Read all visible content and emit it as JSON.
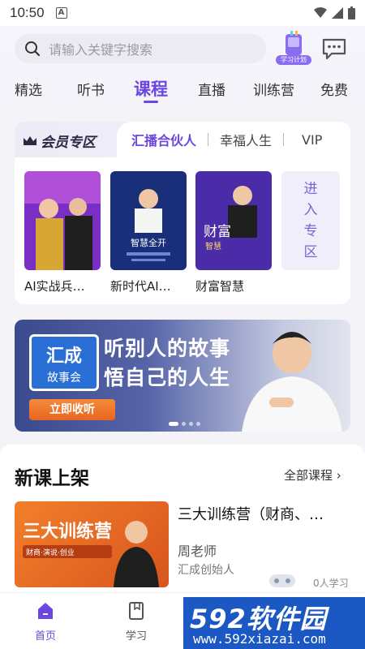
{
  "status_bar": {
    "time": "10:50",
    "badge": "A"
  },
  "search": {
    "placeholder": "请输入关键字搜索",
    "study_plan_label": "学习计划"
  },
  "tabs": [
    "精选",
    "听书",
    "课程",
    "直播",
    "训练营",
    "免费"
  ],
  "active_tab": "课程",
  "vip_zone": {
    "title": "会员专区",
    "tabs": [
      "汇播合伙人",
      "幸福人生",
      "VIP"
    ],
    "items": [
      {
        "title": "AI实战兵…"
      },
      {
        "title": "新时代AI…"
      },
      {
        "title": "财富智慧"
      }
    ],
    "enter_label": [
      "进",
      "入",
      "专",
      "区"
    ],
    "cover_texts": {
      "book3_big": "财富",
      "book3_small": "智慧",
      "book2_text": "智慧全开"
    }
  },
  "banner": {
    "logo_top": "汇成",
    "logo_bottom": "故事会",
    "slogan_line1": "听别人的故事",
    "slogan_line2": "悟自己的人生",
    "button": "立即收听"
  },
  "new_courses": {
    "title": "新课上架",
    "all_link": "全部课程",
    "course": {
      "title": "三大训练营（财商、…",
      "thumb_text": "三大训练营",
      "thumb_sub": "财商·演说·创业",
      "teacher": "周老师",
      "role": "汇成创始人",
      "learners": "0人学习"
    }
  },
  "bottom_nav": [
    {
      "label": "首页",
      "active": true
    },
    {
      "label": "学习",
      "active": false
    }
  ],
  "watermark": {
    "brand": "592软件园",
    "url": "www.592xiazai.com"
  },
  "colors": {
    "accent": "#6b46e0",
    "banner_button": "#e86720",
    "watermark": "#1b58c4"
  }
}
